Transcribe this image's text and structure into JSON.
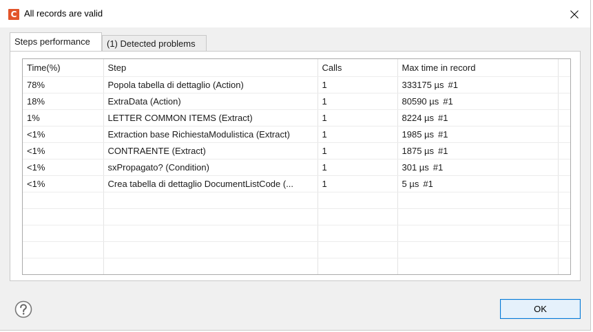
{
  "window": {
    "title": "All records are valid",
    "app_icon_letter": "C"
  },
  "tabs": [
    {
      "label": "Steps performance",
      "active": true
    },
    {
      "label": "(1) Detected problems",
      "active": false
    }
  ],
  "table": {
    "headers": [
      "Time(%)",
      "Step",
      "Calls",
      "Max time in record"
    ],
    "rows": [
      {
        "time": "78%",
        "step": "Popola tabella di dettaglio (Action)",
        "calls": "1",
        "max": "333175 µs",
        "record": "#1"
      },
      {
        "time": "18%",
        "step": "ExtraData (Action)",
        "calls": "1",
        "max": "80590 µs",
        "record": "#1"
      },
      {
        "time": "1%",
        "step": "LETTER COMMON ITEMS (Extract)",
        "calls": "1",
        "max": "8224 µs",
        "record": "#1"
      },
      {
        "time": "<1%",
        "step": "Extraction base RichiestaModulistica  (Extract)",
        "calls": "1",
        "max": "1985 µs",
        "record": "#1"
      },
      {
        "time": "<1%",
        "step": "CONTRAENTE (Extract)",
        "calls": "1",
        "max": "1875 µs",
        "record": "#1"
      },
      {
        "time": "<1%",
        "step": "sxPropagato? (Condition)",
        "calls": "1",
        "max": "301 µs",
        "record": "#1"
      },
      {
        "time": "<1%",
        "step": "Crea tabella di dettaglio DocumentListCode (...",
        "calls": "1",
        "max": "5 µs",
        "record": "#1"
      }
    ],
    "empty_rows": 5
  },
  "footer": {
    "ok_label": "OK",
    "help_icon": "help-icon"
  },
  "colors": {
    "accent": "#0078d7",
    "app_icon": "#e2542a"
  }
}
